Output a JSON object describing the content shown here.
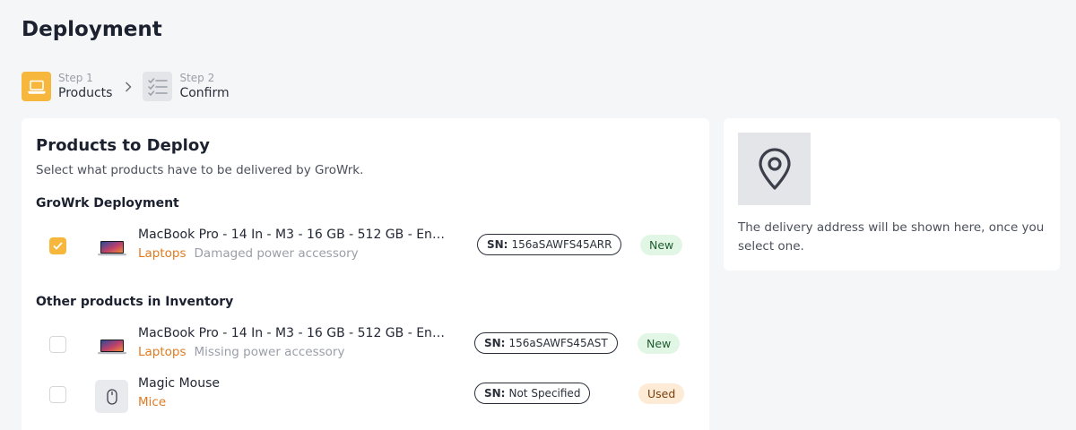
{
  "page": {
    "title": "Deployment"
  },
  "stepper": {
    "steps": [
      {
        "number": "Step 1",
        "label": "Products",
        "state": "active",
        "icon": "laptop-icon"
      },
      {
        "number": "Step 2",
        "label": "Confirm",
        "state": "inactive",
        "icon": "checklist-icon"
      }
    ]
  },
  "products_card": {
    "title": "Products to Deploy",
    "subtitle": "Select what products have to be delivered by GroWrk.",
    "groups": [
      {
        "title": "GroWrk Deployment",
        "items": [
          {
            "checked": true,
            "name": "MacBook Pro - 14 In - M3 - 16 GB - 512 GB - English...",
            "category": "Laptops",
            "condition": "Damaged power accessory",
            "sn_label": "SN:",
            "sn_value": "156aSAWFS45ARR",
            "status": "New",
            "thumb": "laptop-thumbnail"
          }
        ]
      },
      {
        "title": "Other products in Inventory",
        "items": [
          {
            "checked": false,
            "name": "MacBook Pro - 14 In - M3 - 16 GB - 512 GB - Englis...",
            "category": "Laptops",
            "condition": "Missing power accessory",
            "sn_label": "SN:",
            "sn_value": "156aSAWFS45AST",
            "status": "New",
            "thumb": "laptop-thumbnail"
          },
          {
            "checked": false,
            "name": "Magic Mouse",
            "category": "Mice",
            "condition": "",
            "sn_label": "SN:",
            "sn_value": "Not Specified",
            "status": "Used",
            "thumb": "mouse-icon"
          }
        ]
      }
    ]
  },
  "address_card": {
    "icon": "location-pin-icon",
    "text": "The delivery address will be shown here, once you select one."
  },
  "colors": {
    "accent": "#f6b73c",
    "category": "#e07b21",
    "new_badge_bg": "#e2f6e6",
    "used_badge_bg": "#fdebd6"
  }
}
